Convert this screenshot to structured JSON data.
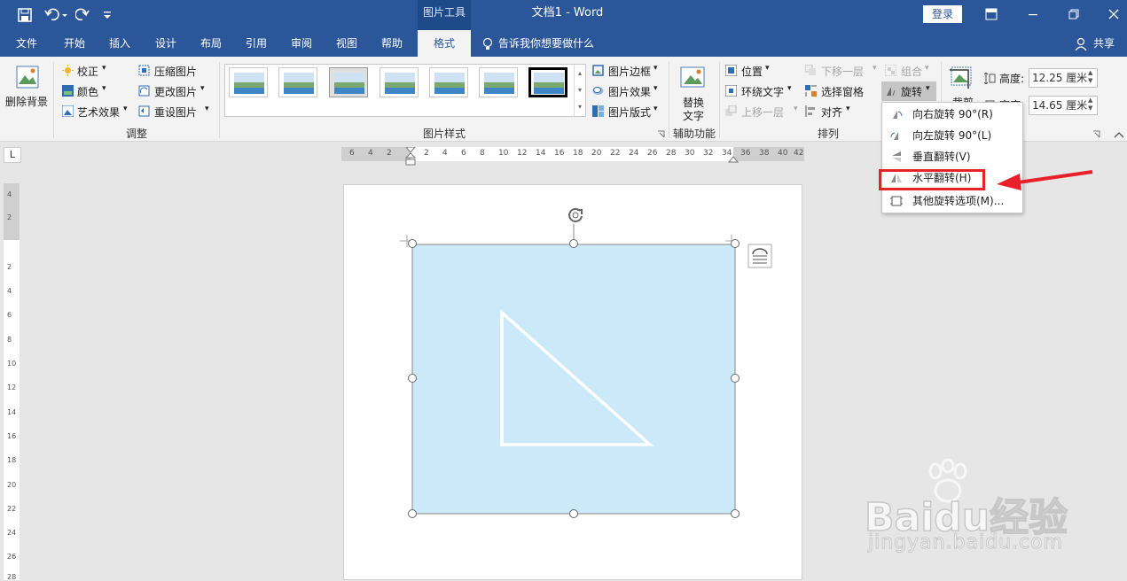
{
  "titlebar": {
    "context_tab": "图片工具",
    "title": "文档1  -  Word",
    "login": "登录",
    "qat": [
      "save-icon",
      "undo-icon",
      "redo-icon",
      "customize-icon"
    ],
    "window": [
      "ribbon-display-icon",
      "minimize-icon",
      "restore-icon",
      "close-icon"
    ]
  },
  "tabs": [
    "文件",
    "开始",
    "插入",
    "设计",
    "布局",
    "引用",
    "审阅",
    "视图",
    "帮助",
    "格式"
  ],
  "active_tab": "格式",
  "tell_me": "告诉我你想要做什么",
  "share": "共享",
  "ribbon": {
    "remove_bg": "删除背景",
    "adjust": {
      "corrections": "校正",
      "color": "颜色",
      "artistic": "艺术效果",
      "compress": "压缩图片",
      "change": "更改图片",
      "reset": "重设图片",
      "label": "调整"
    },
    "styles": {
      "border": "图片边框",
      "effects": "图片效果",
      "layout": "图片版式",
      "label": "图片样式"
    },
    "alt_text": {
      "line1": "替换",
      "line2": "文字",
      "label": "辅助功能"
    },
    "arrange": {
      "position": "位置",
      "wrap": "环绕文字",
      "forward": "上移一层",
      "backward": "下移一层",
      "selection": "选择窗格",
      "align": "对齐",
      "group": "组合",
      "rotate": "旋转",
      "label": "排列"
    },
    "size": {
      "crop": "裁剪",
      "height_label": "高度:",
      "height": "12.25 厘米",
      "width_label": "宽度:",
      "width": "14.65 厘米"
    }
  },
  "rotate_menu": [
    {
      "label": "向右旋转 90°(R)",
      "icon": "rotate-right-icon"
    },
    {
      "label": "向左旋转 90°(L)",
      "icon": "rotate-left-icon"
    },
    {
      "label": "垂直翻转(V)",
      "icon": "flip-vertical-icon"
    },
    {
      "label": "水平翻转(H)",
      "icon": "flip-horizontal-icon"
    },
    {
      "label": "其他旋转选项(M)...",
      "icon": "more-rotation-icon"
    }
  ],
  "ruler": {
    "h": [
      "6",
      "4",
      "2",
      "2",
      "4",
      "6",
      "8",
      "10",
      "12",
      "14",
      "16",
      "18",
      "20",
      "22",
      "24",
      "26",
      "28",
      "30",
      "32",
      "34",
      "36",
      "38",
      "40",
      "42"
    ],
    "v": [
      "4",
      "2",
      "2",
      "4",
      "6",
      "8",
      "10",
      "12",
      "14",
      "16",
      "18",
      "20",
      "22",
      "24",
      "26",
      "28"
    ]
  },
  "watermark": {
    "brand": "Baidu经验",
    "url": "jingyan.baidu.com"
  },
  "colors": {
    "accent": "#2b579a",
    "highlight": "#e8202a",
    "picture": "#cce9f9"
  }
}
